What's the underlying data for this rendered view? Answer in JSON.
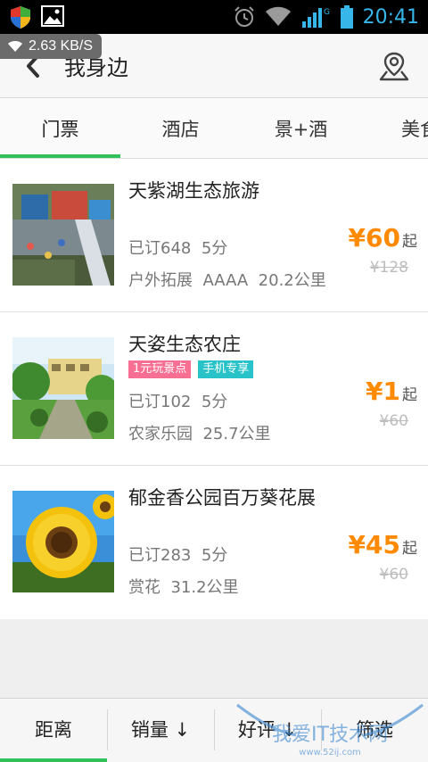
{
  "status_bar": {
    "time": "20:41",
    "network_speed": "2.63 KB/S",
    "network_type": "G",
    "icons": [
      "shield-icon",
      "image-icon",
      "alarm-icon",
      "wifi-icon",
      "signal-icon",
      "battery-icon"
    ]
  },
  "header": {
    "title": "我身边",
    "back_icon": "chevron-left-icon",
    "location_icon": "map-pin-icon"
  },
  "tabs": [
    {
      "label": "门票",
      "active": true
    },
    {
      "label": "酒店",
      "active": false
    },
    {
      "label": "景+酒",
      "active": false
    },
    {
      "label": "美食",
      "active": false
    }
  ],
  "items": [
    {
      "name": "天紫湖生态旅游",
      "tags": [],
      "sold": "已订648",
      "score": "5分",
      "category": "户外拓展",
      "level": "AAAA",
      "distance": "20.2公里",
      "price": "¥60",
      "price_suffix": "起",
      "original_price": "¥128"
    },
    {
      "name": "天姿生态农庄",
      "tags": [
        {
          "label": "1元玩景点",
          "color": "#f76f93"
        },
        {
          "label": "手机专享",
          "color": "#27c3c9"
        }
      ],
      "sold": "已订102",
      "score": "5分",
      "category": "农家乐园",
      "level": "",
      "distance": "25.7公里",
      "price": "¥1",
      "price_suffix": "起",
      "original_price": "¥60"
    },
    {
      "name": "郁金香公园百万葵花展",
      "tags": [],
      "sold": "已订283",
      "score": "5分",
      "category": "赏花",
      "level": "",
      "distance": "31.2公里",
      "price": "¥45",
      "price_suffix": "起",
      "original_price": "¥60"
    }
  ],
  "bottom_bar": [
    {
      "label": "距离",
      "active": true
    },
    {
      "label": "销量 ↓",
      "active": false
    },
    {
      "label": "好评 ↓",
      "active": false
    },
    {
      "label": "筛选",
      "active": false
    }
  ],
  "watermark": {
    "text": "我爱IT技术网",
    "url": "www.52ij.com"
  },
  "colors": {
    "accent": "#2fc25a",
    "price": "#ff8a00",
    "clock": "#37b6ea"
  }
}
